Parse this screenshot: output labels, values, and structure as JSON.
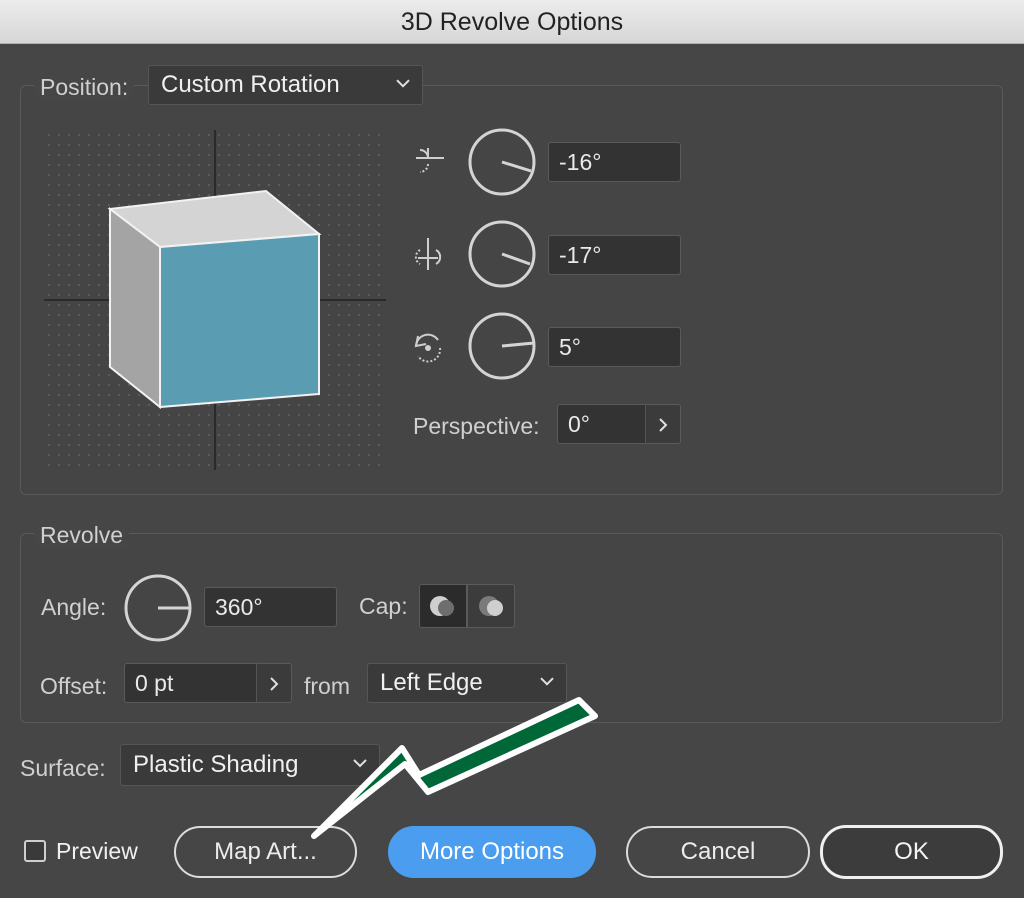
{
  "window": {
    "title": "3D Revolve Options"
  },
  "position": {
    "label": "Position:",
    "selected": "Custom Rotation",
    "x_rotation": "-16°",
    "y_rotation": "-17°",
    "z_rotation": "5°",
    "perspective_label": "Perspective:",
    "perspective_value": "0°"
  },
  "revolve": {
    "group_label": "Revolve",
    "angle_label": "Angle:",
    "angle_value": "360°",
    "cap_label": "Cap:",
    "offset_label": "Offset:",
    "offset_value": "0 pt",
    "from_label": "from",
    "from_selected": "Left Edge"
  },
  "surface": {
    "label": "Surface:",
    "selected": "Plastic Shading"
  },
  "footer": {
    "preview_label": "Preview",
    "preview_checked": false,
    "map_art_label": "Map Art...",
    "more_options_label": "More Options",
    "cancel_label": "Cancel",
    "ok_label": "OK"
  },
  "colors": {
    "dialog_bg": "#464646",
    "accent_blue": "#4b9eef",
    "cube_front": "#5a9db3",
    "annotation_arrow": "#006838"
  },
  "icons": [
    "x-axis-rotation-icon",
    "y-axis-rotation-icon",
    "z-axis-rotation-icon",
    "chevron-down-icon",
    "chevron-right-icon",
    "cap-on-icon",
    "cap-off-icon",
    "annotation-arrow"
  ]
}
